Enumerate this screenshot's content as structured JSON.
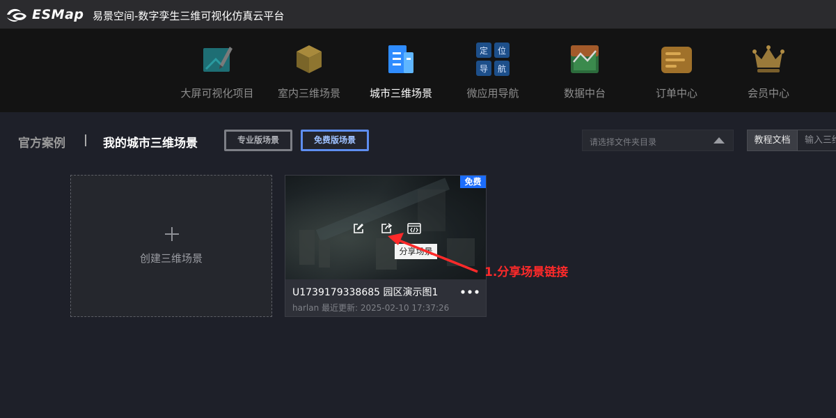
{
  "titlebar": {
    "brand": "ESMap",
    "title": "易景空间-数字孪生三维可视化仿真云平台"
  },
  "nav": {
    "items": [
      {
        "label": "大屏可视化项目",
        "icon": "dashboard-pen-icon"
      },
      {
        "label": "室内三维场景",
        "icon": "cube-icon"
      },
      {
        "label": "城市三维场景",
        "icon": "city-building-icon",
        "active": true
      },
      {
        "label": "微应用导航",
        "icon": "nav-grid-icon",
        "glyphs": [
          "定",
          "位",
          "导",
          "航"
        ]
      },
      {
        "label": "数据中台",
        "icon": "chart-icon"
      },
      {
        "label": "订单中心",
        "icon": "order-doc-icon"
      },
      {
        "label": "会员中心",
        "icon": "crown-icon"
      }
    ]
  },
  "toolbar": {
    "tab_official": "官方案例",
    "tab_mine": "我的城市三维场景",
    "chip_pro": "专业版场景",
    "chip_free": "免费版场景",
    "folder_placeholder": "请选择文件夹目录",
    "doc_button": "教程文档",
    "search_placeholder": "输入三维"
  },
  "create_card": {
    "label": "创建三维场景"
  },
  "scene_card": {
    "badge": "免费",
    "tooltip": "分享场景",
    "name": "U1739179338685 园区演示图1",
    "meta": "harlan 最近更新: 2025-02-10 17:37:26"
  },
  "annotation": {
    "text": "1.分享场景链接"
  },
  "colors": {
    "accent_blue": "#1c6dfb",
    "annotation_red": "#ff2a2a"
  }
}
